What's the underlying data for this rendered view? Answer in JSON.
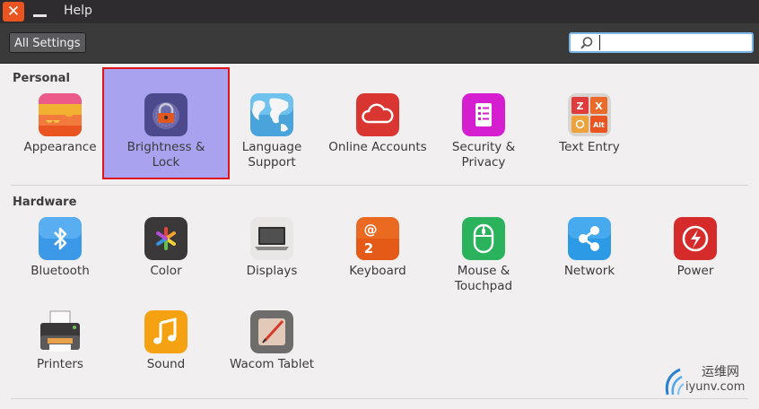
{
  "titlebar": {
    "menu_help": "Help",
    "close_glyph": "✕"
  },
  "toolbar": {
    "all_settings": "All Settings",
    "search_placeholder": ""
  },
  "sections": {
    "personal": "Personal",
    "hardware": "Hardware"
  },
  "personal": [
    {
      "id": "appearance",
      "label": "Appearance",
      "icon": "appearance-icon"
    },
    {
      "id": "brightness",
      "label": "Brightness & Lock",
      "icon": "padlock-icon",
      "selected": true
    },
    {
      "id": "language",
      "label": "Language Support",
      "icon": "globe-icon"
    },
    {
      "id": "online",
      "label": "Online Accounts",
      "icon": "cloud-icon"
    },
    {
      "id": "security",
      "label": "Security & Privacy",
      "icon": "security-icon"
    },
    {
      "id": "textentry",
      "label": "Text Entry",
      "icon": "keys-icon"
    }
  ],
  "hardware": [
    {
      "id": "bluetooth",
      "label": "Bluetooth",
      "icon": "bluetooth-icon"
    },
    {
      "id": "color",
      "label": "Color",
      "icon": "color-wheel-icon"
    },
    {
      "id": "displays",
      "label": "Displays",
      "icon": "monitor-icon"
    },
    {
      "id": "keyboard",
      "label": "Keyboard",
      "icon": "keyboard-key-icon"
    },
    {
      "id": "mouse",
      "label": "Mouse & Touchpad",
      "icon": "mouse-icon"
    },
    {
      "id": "network",
      "label": "Network",
      "icon": "network-icon"
    },
    {
      "id": "power",
      "label": "Power",
      "icon": "power-icon"
    },
    {
      "id": "printers",
      "label": "Printers",
      "icon": "printer-icon"
    },
    {
      "id": "sound",
      "label": "Sound",
      "icon": "music-note-icon"
    },
    {
      "id": "wacom",
      "label": "Wacom Tablet",
      "icon": "tablet-icon"
    }
  ],
  "textentry_keys": [
    "Z",
    "X",
    "Alt"
  ],
  "keyboard_keys": [
    "@",
    "2"
  ],
  "watermark": {
    "cn": "运维网",
    "url": "iyunv.com"
  },
  "colors": {
    "accent": "#e95420",
    "selection": "#a9a2ee",
    "selection_border": "#e0141a"
  }
}
